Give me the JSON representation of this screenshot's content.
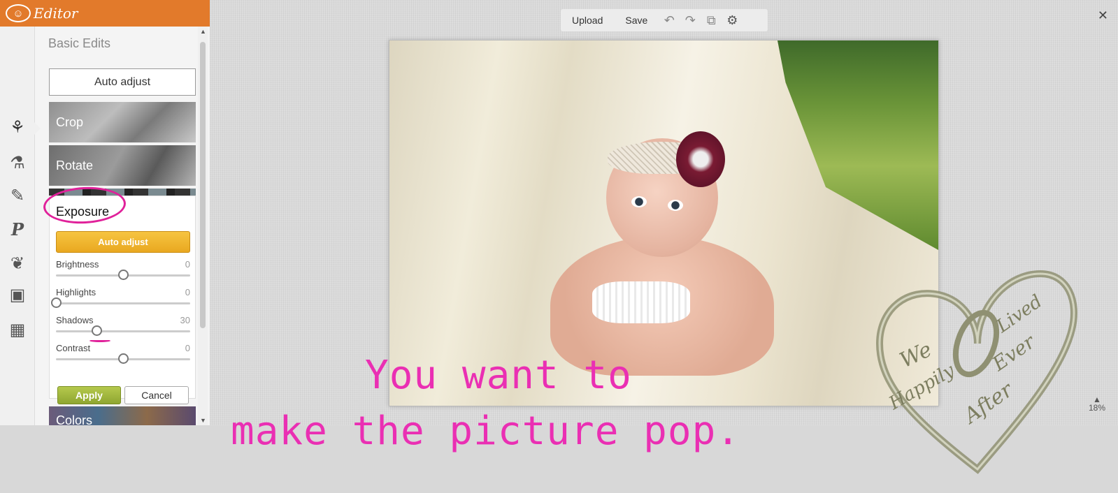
{
  "app": {
    "title": "Editor",
    "accent": "#e27a2b"
  },
  "sidebar": {
    "tools": [
      "effects-icon",
      "flask-icon",
      "brush-icon",
      "text-icon",
      "sticker-icon",
      "frame-icon",
      "texture-icon"
    ],
    "heading": "Basic Edits",
    "auto_adjust": "Auto adjust",
    "tiles": {
      "crop": "Crop",
      "rotate": "Rotate",
      "color": "Colors"
    },
    "exposure": {
      "title": "Exposure",
      "auto_adjust": "Auto adjust",
      "sliders": [
        {
          "label": "Brightness",
          "value": "0",
          "level": 0.5
        },
        {
          "label": "Highlights",
          "value": "0",
          "level": 0.0
        },
        {
          "label": "Shadows",
          "value": "30",
          "level": 0.3
        },
        {
          "label": "Contrast",
          "value": "0",
          "level": 0.5
        }
      ],
      "apply": "Apply",
      "cancel": "Cancel"
    }
  },
  "toolbar": {
    "upload": "Upload",
    "save": "Save"
  },
  "canvas": {
    "zoom": "18%"
  },
  "overlay": {
    "line1": "You want to",
    "line2": "make the picture pop.",
    "color": "#ea2fb3"
  },
  "watermark": {
    "line1": "We",
    "line2": "Lived",
    "line3": "Happily",
    "line4": "Ever",
    "line5": "After"
  }
}
